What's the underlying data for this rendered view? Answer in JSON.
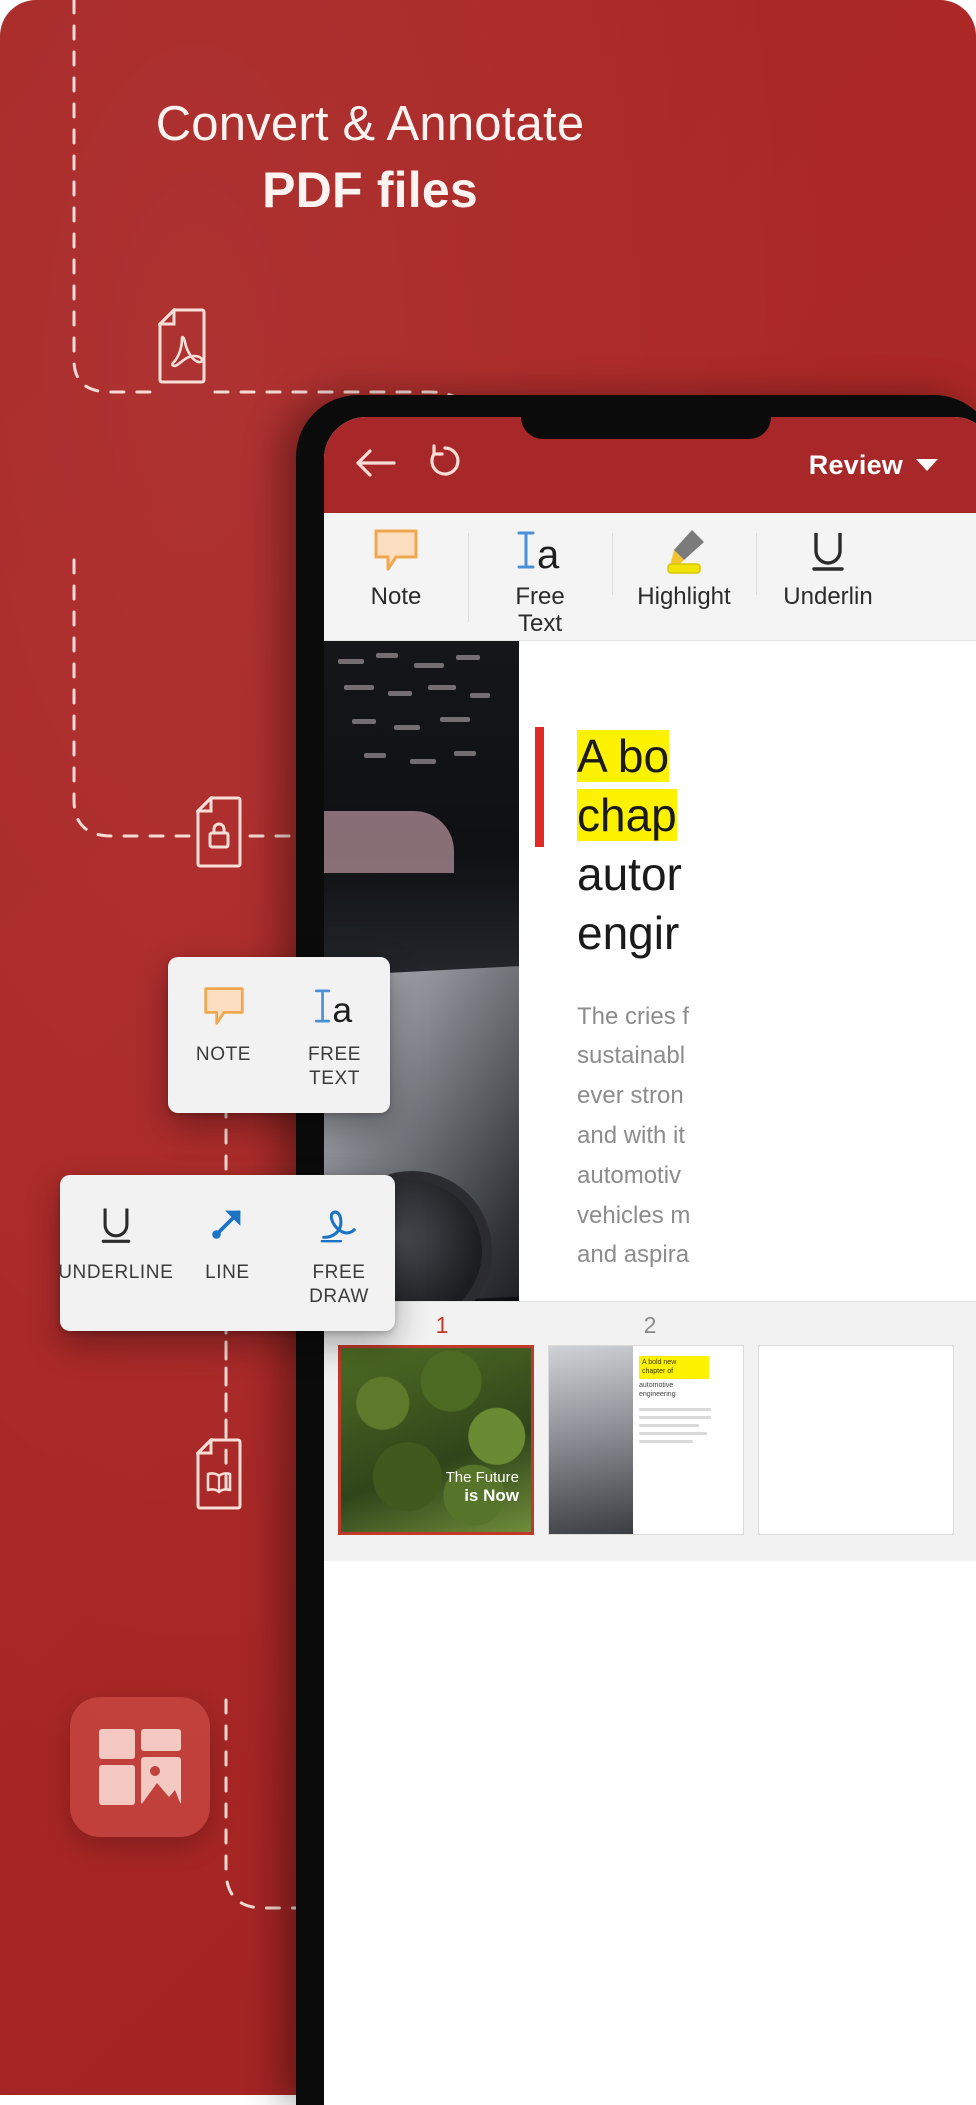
{
  "promo": {
    "headline_line1": "Convert & Annotate",
    "headline_line2": "PDF files",
    "background_color": "#a82726",
    "accent_color": "#c0392b",
    "icons": [
      {
        "name": "pdf-file-icon",
        "label": "PDF document"
      },
      {
        "name": "locked-file-icon",
        "label": "Protected document"
      },
      {
        "name": "book-file-icon",
        "label": "Read document"
      },
      {
        "name": "app-tile-icon",
        "label": "Office app tile"
      }
    ]
  },
  "phone": {
    "appbar": {
      "back_icon": "arrow-left-icon",
      "undo_icon": "undo-icon",
      "mode_label": "Review",
      "mode_caret": "chevron-down-icon",
      "background_color": "#a8282a"
    },
    "toolstrip": {
      "tools": [
        {
          "label": "Note",
          "icon": "note-bubble-icon",
          "color": "#f6b26b"
        },
        {
          "label": "Free\nText",
          "label_line1": "Free",
          "label_line2": "Text",
          "icon": "free-text-icon",
          "color": "#4a90d9"
        },
        {
          "label": "Highlight",
          "icon": "highlighter-icon",
          "color": "#f2e205"
        },
        {
          "label": "Underline",
          "label_truncated": "Underlin",
          "icon": "underline-icon",
          "color": "#2b2b2b"
        }
      ]
    },
    "document": {
      "heading_highlighted_line1": "A bo",
      "heading_highlighted_line2": "chap",
      "heading_line3": "autor",
      "heading_line4": "engir",
      "highlight_color": "#fff200",
      "margin_bar_color": "#e02a26",
      "body_lines": [
        "The cries f",
        "sustainabl",
        "ever stron",
        "and with it",
        "automotiv",
        "vehicles m",
        "and aspira"
      ]
    },
    "thumbnails": {
      "page_numbers": [
        "1",
        "2"
      ],
      "active_page": "1",
      "thumb1_caption_line1": "The Future",
      "thumb1_caption_line2": "is Now",
      "thumb2_text_line1": "A bold new",
      "thumb2_text_line2": "chapter of",
      "thumb2_text_line3": "automotive",
      "thumb2_text_line4": "engineering"
    }
  },
  "cards": {
    "card_note": {
      "items": [
        {
          "label": "NOTE",
          "icon": "note-bubble-icon"
        },
        {
          "label_line1": "FREE",
          "label_line2": "TEXT",
          "icon": "free-text-icon"
        }
      ]
    },
    "card_draw": {
      "items": [
        {
          "label": "UNDERLINE",
          "icon": "underline-icon"
        },
        {
          "label": "LINE",
          "icon": "arrow-line-icon"
        },
        {
          "label_line1": "FREE",
          "label_line2": "DRAW",
          "icon": "free-draw-icon"
        }
      ]
    }
  }
}
